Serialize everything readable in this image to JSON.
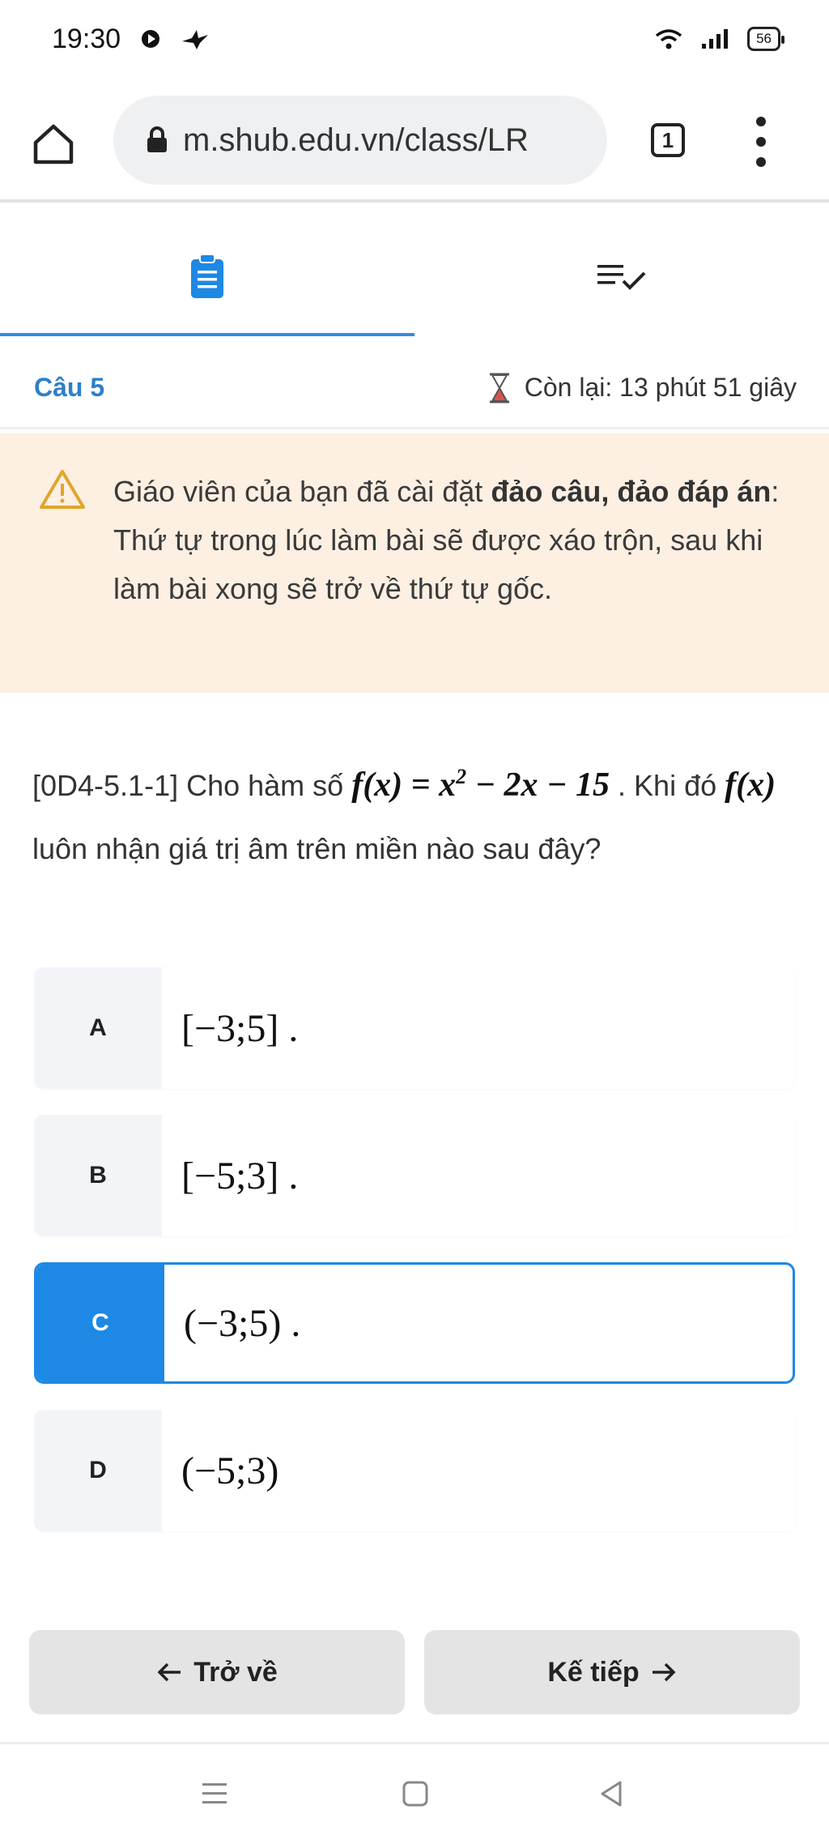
{
  "status_bar": {
    "time": "19:30",
    "battery": "56"
  },
  "browser": {
    "url": "m.shub.edu.vn/class/LR",
    "tab_count": "1"
  },
  "tabs": [
    {
      "icon": "clipboard-icon"
    },
    {
      "icon": "checklist-icon"
    }
  ],
  "question_bar": {
    "number": "Câu 5",
    "timer": "Còn lại: 13 phút 51 giây"
  },
  "notice": {
    "prefix": "Giáo viên của bạn đã cài đặt ",
    "bold": "đảo câu, đảo đáp án",
    "suffix": ": Thứ tự trong lúc làm bài sẽ được xáo trộn, sau khi làm bài xong sẽ trở về thứ tự gốc."
  },
  "question": {
    "code": "[0D4-5.1-1] Cho hàm số",
    "formula_f": "f(x)",
    "formula_rest": "= x",
    "formula_exp": "2",
    "formula_tail": " − 2x − 15",
    "mid": ". Khi đó",
    "fx": "f(x)",
    "end": "luôn nhận giá trị âm trên miền nào sau đây?"
  },
  "options": [
    {
      "letter": "A",
      "value": "[−3;5] ."
    },
    {
      "letter": "B",
      "value": "[−5;3] ."
    },
    {
      "letter": "C",
      "value": "(−3;5) ."
    },
    {
      "letter": "D",
      "value": "(−5;3)"
    }
  ],
  "selected_option": "C",
  "colors": {
    "accent": "#1e88e5",
    "notice_bg": "#fdefe2"
  },
  "buttons": {
    "back": "Trở về",
    "next": "Kế tiếp"
  }
}
